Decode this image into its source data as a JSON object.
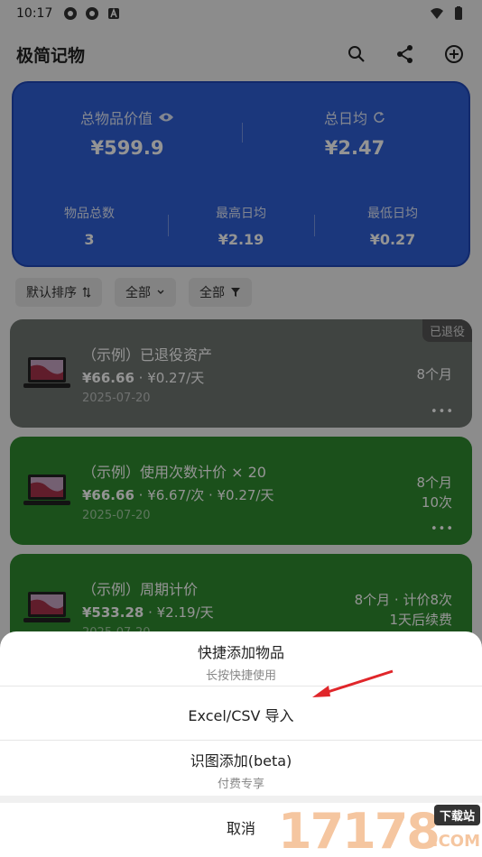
{
  "status_bar": {
    "time": "10:17",
    "icons": [
      "vpn-icon",
      "vpn-icon",
      "a-icon"
    ],
    "right_icons": [
      "wifi-icon",
      "battery-icon"
    ]
  },
  "app_bar": {
    "title": "极简记物",
    "actions": [
      "search-icon",
      "share-icon",
      "add-circle-icon"
    ]
  },
  "summary": {
    "total_value_label": "总物品价值",
    "total_value": "¥599.9",
    "daily_avg_label": "总日均",
    "daily_avg": "¥2.47",
    "count_label": "物品总数",
    "count": "3",
    "max_daily_label": "最高日均",
    "max_daily": "¥2.19",
    "min_daily_label": "最低日均",
    "min_daily": "¥0.27",
    "color": "#2f5fd6"
  },
  "filters": [
    {
      "label": "默认排序",
      "icon": "sort-icon"
    },
    {
      "label": "全部",
      "icon": "chevron-down-icon"
    },
    {
      "label": "全部",
      "icon": "filter-icon"
    }
  ],
  "items": [
    {
      "name": "（示例）已退役资产",
      "price": "¥66.66",
      "extra": " · ¥0.27/天",
      "date": "2025-07-20",
      "right1": "8个月",
      "right2": "",
      "tag": "已退役",
      "color": "#6f7671"
    },
    {
      "name": "（示例）使用次数计价 × 20",
      "price": "¥66.66",
      "extra": " · ¥6.67/次 · ¥0.27/天",
      "date": "2025-07-20",
      "right1": "8个月",
      "right2": "10次",
      "tag": "",
      "color": "#2f8a2f"
    },
    {
      "name": "（示例）周期计价",
      "price": "¥533.28",
      "extra": " · ¥2.19/天",
      "date": "2025-07-20",
      "right1": "8个月 · 计价8次",
      "right2": "1天后续费",
      "tag": "",
      "color": "#2f8a2f"
    }
  ],
  "sheet": {
    "option1_title": "快捷添加物品",
    "option1_sub": "长按快捷使用",
    "option2_title": "Excel/CSV 导入",
    "option3_title": "识图添加(beta)",
    "option3_sub": "付费专享",
    "cancel": "取消"
  },
  "watermark": {
    "number": "17178",
    "tag": "下载站",
    "suffix": ".COM"
  },
  "colors": {
    "arrow": "#e0262a"
  }
}
